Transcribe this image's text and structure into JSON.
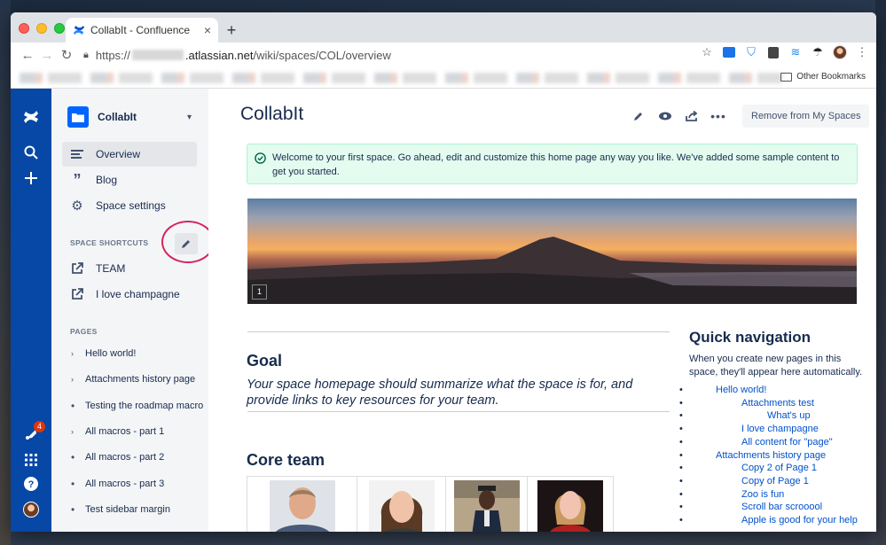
{
  "browser": {
    "tab_title": "CollabIt - Confluence",
    "tab_close": "×",
    "new_tab": "+",
    "url_prefix": "https://",
    "url_host": ".atlassian.net",
    "url_path": "/wiki/spaces/COL/overview",
    "other_bookmarks": "Other Bookmarks"
  },
  "globalnav": {
    "notification_count": "4"
  },
  "sidebar": {
    "space_name": "CollabIt",
    "nav": [
      {
        "label": "Overview",
        "icon": "overview-icon"
      },
      {
        "label": "Blog",
        "icon": "quote-icon"
      },
      {
        "label": "Space settings",
        "icon": "gear-icon"
      }
    ],
    "shortcuts_label": "SPACE SHORTCUTS",
    "shortcuts": [
      {
        "label": "TEAM",
        "icon": "external-link-icon"
      },
      {
        "label": "I love champagne",
        "icon": "external-link-icon"
      }
    ],
    "pages_label": "PAGES",
    "pages": [
      {
        "label": "Hello world!",
        "expandable": true
      },
      {
        "label": "Attachments history page",
        "expandable": true
      },
      {
        "label": "Testing the roadmap macro",
        "expandable": false
      },
      {
        "label": "All macros - part 1",
        "expandable": true
      },
      {
        "label": "All macros - part 2",
        "expandable": false
      },
      {
        "label": "All macros - part 3",
        "expandable": false
      },
      {
        "label": "Test sidebar margin",
        "expandable": false
      }
    ]
  },
  "main": {
    "title": "CollabIt",
    "remove_button": "Remove from My Spaces",
    "notice": "Welcome to your first space. Go ahead, edit and customize this home page any way you like. We've added some sample content to get you started.",
    "hero_badge": "1",
    "goal_heading": "Goal",
    "goal_text": "Your space homepage should summarize what the space is for, and provide links to key resources for your team.",
    "core_team_heading": "Core team",
    "quick_nav_heading": "Quick navigation",
    "quick_nav_text": "When you create new pages in this space, they'll appear here automatically.",
    "quick_nav_items": [
      {
        "label": "Hello world!",
        "level": 1
      },
      {
        "label": "Attachments test",
        "level": 2
      },
      {
        "label": "What's up",
        "level": 3
      },
      {
        "label": "I love champagne",
        "level": 2
      },
      {
        "label": "All content for \"page\"",
        "level": 2
      },
      {
        "label": "Attachments history page",
        "level": 1
      },
      {
        "label": "Copy 2 of Page 1",
        "level": 2
      },
      {
        "label": "Copy of Page 1",
        "level": 2
      },
      {
        "label": "Zoo is fun",
        "level": 2
      },
      {
        "label": "Scroll bar scrooool",
        "level": 2
      },
      {
        "label": "Apple is good for your help",
        "level": 2
      }
    ]
  },
  "colors": {
    "global_nav": "#0747a6",
    "link": "#0052cc",
    "annotation_circle": "#d6245b",
    "notice_bg": "#e3fcef"
  }
}
